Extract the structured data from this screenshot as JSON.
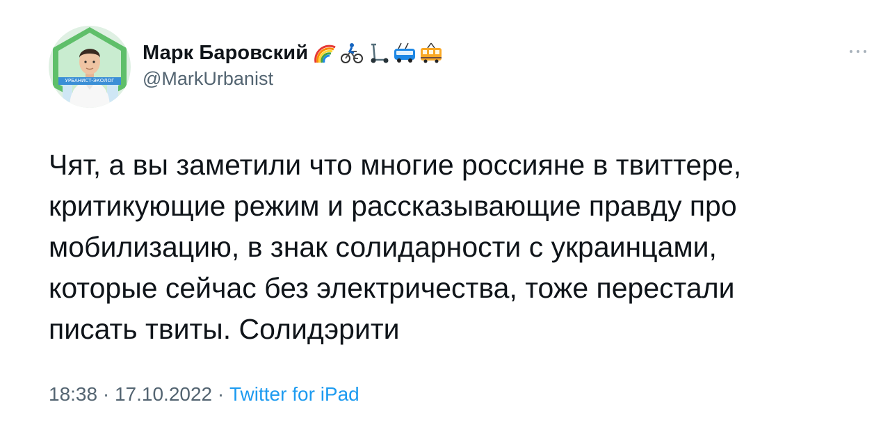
{
  "author": {
    "display_name": "Марк Баровский",
    "handle": "@MarkUrbanist",
    "avatar_badge_text": "УРБАНИСТ-ЭКОЛОГ",
    "name_emojis": [
      "rainbow-icon",
      "cyclist-icon",
      "scooter-icon",
      "trolleybus-icon",
      "tram-icon"
    ]
  },
  "tweet": {
    "text": "Чят, а вы заметили что многие россияне в твиттере,\nкритикующие режим и рассказывающие правду про\nмобилизацию, в знак солидарности с украинцами,\nкоторые сейчас без электричества, тоже перестали\nписать твиты. Солидэрити",
    "time": "18:38",
    "date": "17.10.2022",
    "separator": " · ",
    "source": "Twitter for iPad"
  },
  "colors": {
    "text_primary": "#0f1419",
    "text_secondary": "#536471",
    "link": "#1d9bf0",
    "avatar_ring": "#7fc97f"
  },
  "icons": {
    "more": "more-horizontal-icon"
  }
}
